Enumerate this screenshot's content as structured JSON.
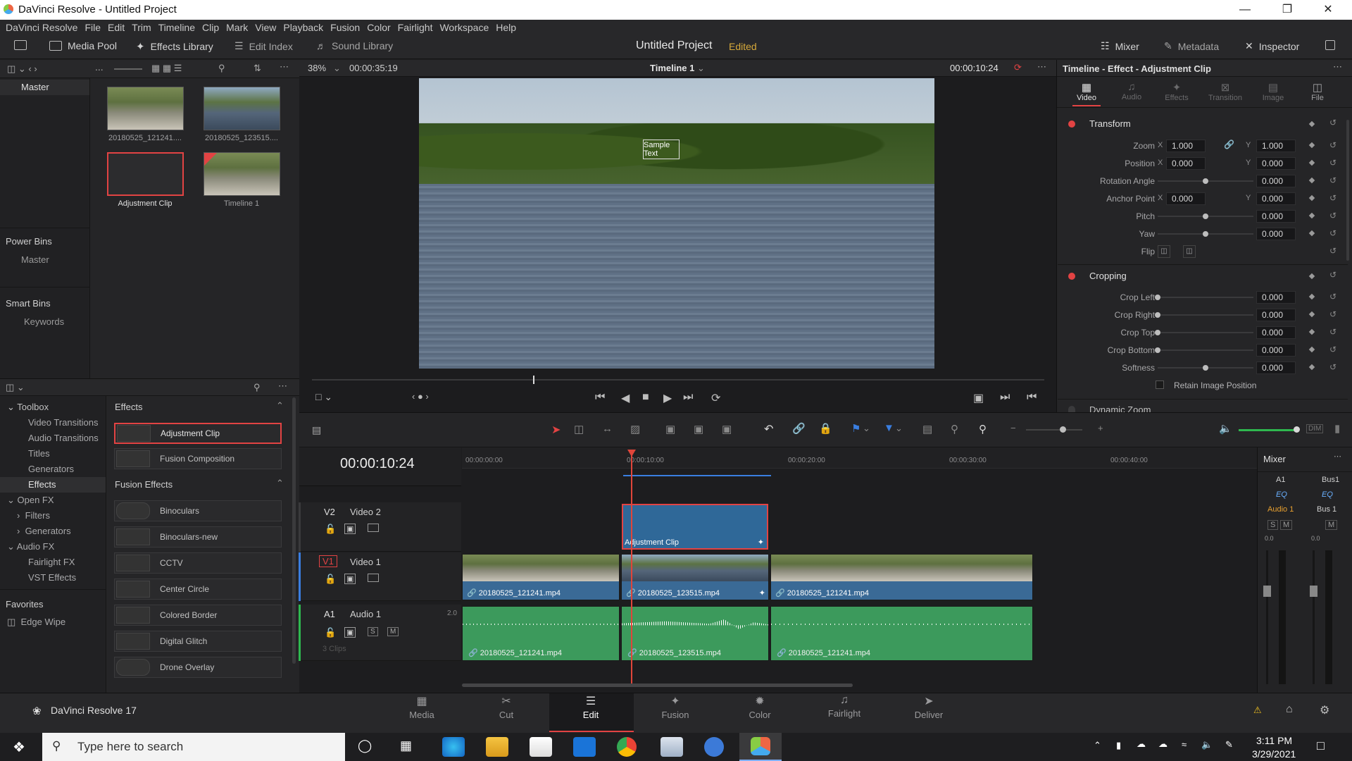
{
  "window": {
    "title": "DaVinci Resolve - Untitled Project"
  },
  "menu": [
    "DaVinci Resolve",
    "File",
    "Edit",
    "Trim",
    "Timeline",
    "Clip",
    "Mark",
    "View",
    "Playback",
    "Fusion",
    "Color",
    "Fairlight",
    "Workspace",
    "Help"
  ],
  "toolbar": {
    "media_pool": "Media Pool",
    "effects_library": "Effects Library",
    "edit_index": "Edit Index",
    "sound_library": "Sound Library",
    "project_title": "Untitled Project",
    "project_status": "Edited",
    "mixer": "Mixer",
    "metadata": "Metadata",
    "inspector": "Inspector"
  },
  "media_pool": {
    "master": "Master",
    "power_bins": "Power Bins",
    "power_master": "Master",
    "smart_bins": "Smart Bins",
    "keywords": "Keywords",
    "clips": [
      {
        "name": "20180525_121241...."
      },
      {
        "name": "20180525_123515...."
      },
      {
        "name": "Adjustment Clip"
      },
      {
        "name": "Timeline 1"
      }
    ]
  },
  "effects_panel": {
    "toolbox": "Toolbox",
    "tree": [
      "Video Transitions",
      "Audio Transitions",
      "Titles",
      "Generators",
      "Effects"
    ],
    "open_fx": "Open FX",
    "open_fx_items": [
      "Filters",
      "Generators"
    ],
    "audio_fx": "Audio FX",
    "audio_fx_items": [
      "Fairlight FX",
      "VST Effects"
    ],
    "favorites": "Favorites",
    "favorite_item": "Edge Wipe",
    "effects_header": "Effects",
    "effects_items": [
      "Adjustment Clip",
      "Fusion Composition"
    ],
    "fusion_header": "Fusion Effects",
    "fusion_items": [
      "Binoculars",
      "Binoculars-new",
      "CCTV",
      "Center Circle",
      "Colored Border",
      "Digital Glitch",
      "Drone Overlay"
    ]
  },
  "viewer": {
    "zoom": "38%",
    "duration": "00:00:35:19",
    "timeline_name": "Timeline 1",
    "timecode": "00:00:10:24",
    "overlay_text": "Sample Text"
  },
  "inspector": {
    "title": "Timeline - Effect - Adjustment Clip",
    "tabs": [
      "Video",
      "Audio",
      "Effects",
      "Transition",
      "Image",
      "File"
    ],
    "transform": "Transform",
    "zoom_label": "Zoom",
    "zoom_x": "1.000",
    "zoom_y": "1.000",
    "position_label": "Position",
    "pos_x": "0.000",
    "pos_y": "0.000",
    "rotation_label": "Rotation Angle",
    "rotation": "0.000",
    "anchor_label": "Anchor Point",
    "anchor_x": "0.000",
    "anchor_y": "0.000",
    "pitch_label": "Pitch",
    "pitch": "0.000",
    "yaw_label": "Yaw",
    "yaw": "0.000",
    "flip_label": "Flip",
    "cropping": "Cropping",
    "crop_left_label": "Crop Left",
    "crop_left": "0.000",
    "crop_right_label": "Crop Right",
    "crop_right": "0.000",
    "crop_top_label": "Crop Top",
    "crop_top": "0.000",
    "crop_bottom_label": "Crop Bottom",
    "crop_bottom": "0.000",
    "softness_label": "Softness",
    "softness": "0.000",
    "retain_label": "Retain Image Position",
    "dynamic_zoom": "Dynamic Zoom",
    "x": "X",
    "y": "Y"
  },
  "timeline": {
    "timecode": "00:00:10:24",
    "ruler": [
      "00:00:00:00",
      "00:00:10:00",
      "00:00:20:00",
      "00:00:30:00",
      "00:00:40:00"
    ],
    "v2_id": "V2",
    "v2_name": "Video 2",
    "v1_id": "V1",
    "v1_name": "Video 1",
    "a1_id": "A1",
    "a1_name": "Audio 1",
    "a1_channels": "2.0",
    "a1_clips": "3 Clips",
    "s": "S",
    "m": "M",
    "adj_clip": "Adjustment Clip",
    "video_clips": [
      "20180525_121241.mp4",
      "20180525_123515.mp4",
      "20180525_121241.mp4"
    ],
    "audio_clips": [
      "20180525_121241.mp4",
      "20180525_123515.mp4",
      "20180525_121241.mp4"
    ]
  },
  "mixer": {
    "title": "Mixer",
    "a1": "A1",
    "bus1": "Bus1",
    "eq": "EQ",
    "audio1": "Audio 1",
    "bus1_name": "Bus 1",
    "s": "S",
    "m": "M",
    "db0": "0.0",
    "db0b": "0.0"
  },
  "pages": {
    "app": "DaVinci Resolve 17",
    "tabs": [
      "Media",
      "Cut",
      "Edit",
      "Fusion",
      "Color",
      "Fairlight",
      "Deliver"
    ],
    "active": "Edit"
  },
  "taskbar": {
    "search_placeholder": "Type here to search",
    "time": "3:11 PM",
    "date": "3/29/2021"
  },
  "colors": {
    "accent_red": "#e24343",
    "video_clip": "#3a6a96",
    "audio_clip": "#3c9a5c",
    "playhead": "#e0453a"
  }
}
